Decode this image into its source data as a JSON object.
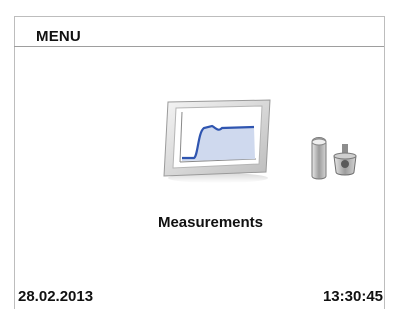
{
  "header": {
    "title": "MENU"
  },
  "menu": {
    "current_label": "Measurements",
    "icon": "measurements-monitor-icon",
    "secondary_icon": "titrator-instrument-icon"
  },
  "status": {
    "date": "28.02.2013",
    "time": "13:30:45"
  },
  "colors": {
    "background": "#ffffff",
    "text": "#111111",
    "divider": "#9e9e9e",
    "curve": "#2f55b0",
    "curve_fill": "#cfd9ee"
  }
}
